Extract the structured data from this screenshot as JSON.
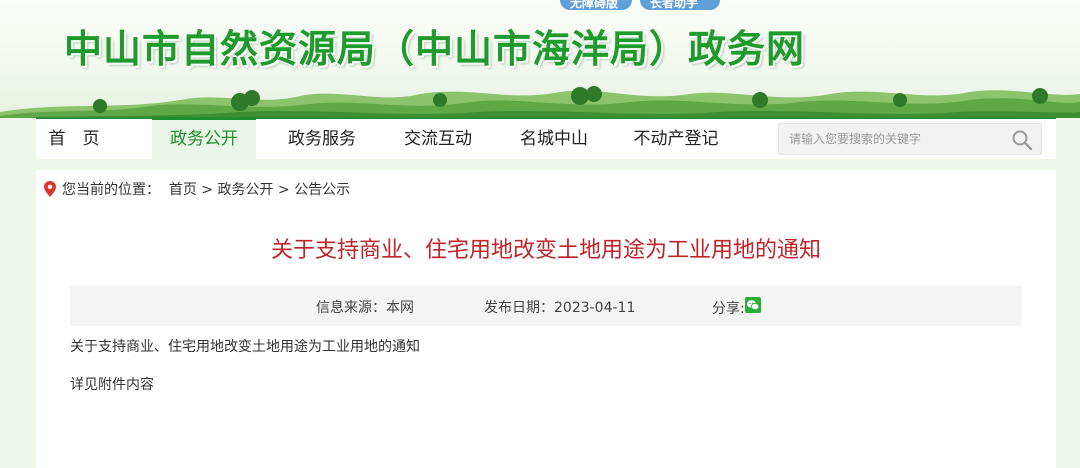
{
  "header": {
    "site_title": "中山市自然资源局（中山市海洋局）政务网",
    "top_links": [
      "无障碍版",
      "长者助手"
    ]
  },
  "nav": {
    "items": [
      {
        "label": "首　页",
        "active": false
      },
      {
        "label": "政务公开",
        "active": true
      },
      {
        "label": "政务服务",
        "active": false
      },
      {
        "label": "交流互动",
        "active": false
      },
      {
        "label": "名城中山",
        "active": false
      },
      {
        "label": "不动产登记",
        "active": false
      }
    ],
    "search_placeholder": "请输入您要搜索的关键字"
  },
  "breadcrumb": {
    "prefix": "您当前的位置：",
    "items": [
      "首页",
      "政务公开",
      "公告公示"
    ],
    "separator": " > "
  },
  "article": {
    "title": "关于支持商业、住宅用地改变土地用途为工业用地的通知",
    "meta": {
      "source": "信息来源：本网",
      "date": "发布日期：2023-04-11",
      "share": "分享:"
    },
    "paragraphs": [
      "关于支持商业、住宅用地改变土地用途为工业用地的通知",
      "详见附件内容"
    ]
  },
  "colors": {
    "brand_green": "#1f9a2c",
    "title_red": "#c0242a",
    "pin_red": "#e0332b"
  }
}
